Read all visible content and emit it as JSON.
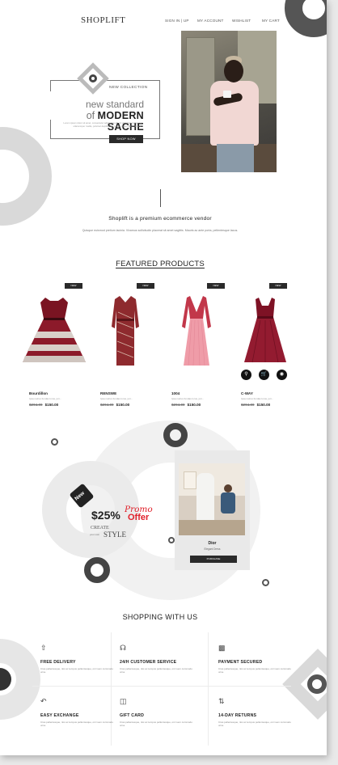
{
  "header": {
    "logo": "SHOPLIFT",
    "nav": [
      "SIGN IN | UP",
      "MY ACCOUNT",
      "WISHLIST",
      "MY CART"
    ]
  },
  "hero": {
    "collection_label": "NEW COLLECTION",
    "headline_light": "new standard",
    "headline_of": "of",
    "headline_bold": "MODERN SACHE",
    "description": "Lorem ipsum dolor sit amet, consectetur adipiscing elit. Ut elit tellus, luctus nec ullamcorper mattis, pulvinar dapibus leo. Lorem ipsum dolor sit amet.",
    "button": "SHOP NOW"
  },
  "intro": {
    "tagline": "Shoplift is a premium ecommerce vendor",
    "description": "Quisque euismod pretium lacinia. Vivamus sollicitudin placerat sit amet sagittis. Mauris ac ante porta, pellentesque lacus."
  },
  "featured": {
    "title": "FEATURED PRODUCTS",
    "products": [
      {
        "badge": "NEW",
        "name": "Bourdillon",
        "sub": "Ipsa natrus fundas lorus, juri...",
        "old_price": "$204.00",
        "price": "$150.00"
      },
      {
        "badge": "NEW",
        "name": "RENSWE",
        "sub": "Ipsa natrus fundas lorus, juri...",
        "old_price": "$204.00",
        "price": "$150.00"
      },
      {
        "badge": "NEW",
        "name": "1004",
        "sub": "Ipsa natrus fundas lorus, juri...",
        "old_price": "$204.00",
        "price": "$150.00"
      },
      {
        "badge": "NEW",
        "name": "C-WAY",
        "sub": "Ipsa natrus fundas lorus, juri...",
        "old_price": "$204.00",
        "price": "$150.00"
      }
    ]
  },
  "promo": {
    "tag": "New",
    "percent": "$25%",
    "promo_word": "Promo",
    "offer_word": "Offer",
    "create": "CREATE",
    "your_own": "your own",
    "style": "STYLE",
    "card_title": "Dior",
    "card_sub": "Elegant Dress",
    "card_button": "PURCHASE"
  },
  "services": {
    "title": "SHOPPING WITH US",
    "items": [
      {
        "icon": "rocket-icon",
        "title": "FREE DELIVERY",
        "desc": "Cras pellentesque, nisi ac tempus pellentesque, orci sem commodo urna."
      },
      {
        "icon": "headset-icon",
        "title": "24/H CUSTOMER SERVICE",
        "desc": "Cras pellentesque, nisi ac tempus pellentesque, orci sem commodo urna."
      },
      {
        "icon": "lock-icon",
        "title": "PAYMENT SECURED",
        "desc": "Cras pellentesque, nisi ac tempus pellentesque, orci sem commodo urna."
      },
      {
        "icon": "return-icon",
        "title": "EASY EXCHANGE",
        "desc": "Cras pellentesque, nisi ac tempus pellentesque, orci sem commodo urna."
      },
      {
        "icon": "gift-icon",
        "title": "GIFT CARD",
        "desc": "Cras pellentesque, nisi ac tempus pellentesque, orci sem commodo urna."
      },
      {
        "icon": "return-arrows-icon",
        "title": "14-DAY RETURNS",
        "desc": "Cras pellentesque, nisi ac tempus pellentesque, orci sem commodo urna."
      }
    ]
  },
  "colors": {
    "accent": "#e0202a",
    "dark": "#2a2a2a",
    "ring": "#dcdcdc"
  }
}
